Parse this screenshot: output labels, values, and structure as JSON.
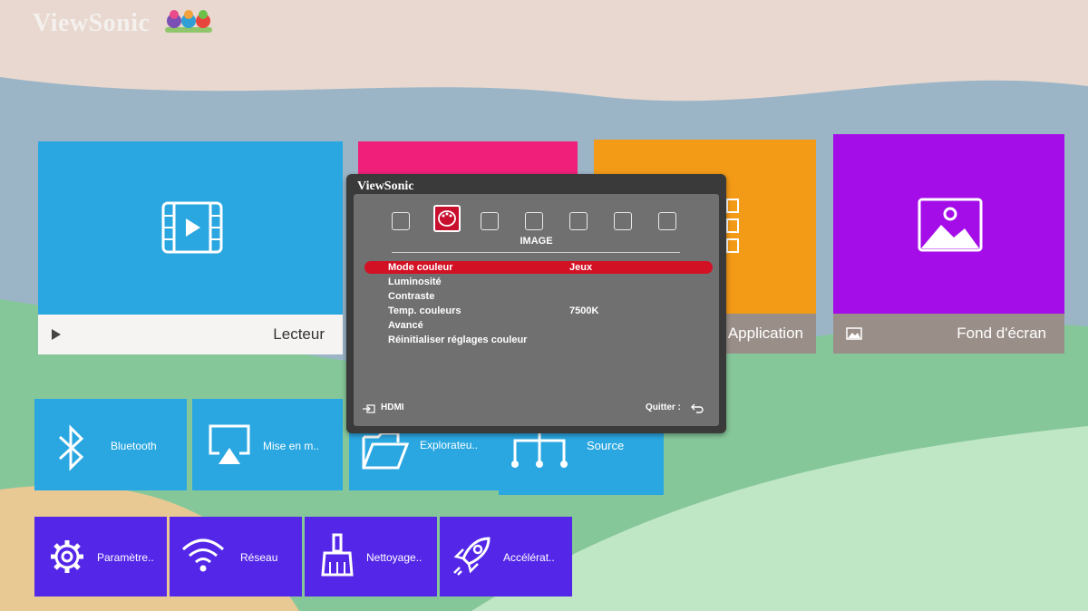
{
  "brand": {
    "name": "ViewSonic"
  },
  "tiles": {
    "lecteur": {
      "label": "Lecteur",
      "icon": "film-play-icon"
    },
    "pink": {
      "label": ""
    },
    "application": {
      "label": "Application",
      "icon": "grid-icon"
    },
    "fond_ecran": {
      "label": "Fond d'écran",
      "icon": "picture-icon"
    },
    "bluetooth": {
      "label": "Bluetooth",
      "icon": "bluetooth-icon"
    },
    "mise_en": {
      "label": "Mise en m..",
      "icon": "screen-cast-icon"
    },
    "explorateur": {
      "label": "Explorateu..",
      "icon": "folder-icon"
    },
    "source": {
      "label": "Source",
      "icon": "source-tree-icon"
    },
    "parametres": {
      "label": "Paramètre..",
      "icon": "gear-icon"
    },
    "reseau": {
      "label": "Réseau",
      "icon": "wifi-icon"
    },
    "nettoyage": {
      "label": "Nettoyage..",
      "icon": "broom-icon"
    },
    "acceleration": {
      "label": "Accélérat..",
      "icon": "rocket-icon"
    }
  },
  "osd": {
    "brand": "ViewSonic",
    "section_title": "IMAGE",
    "tabs": [
      "display-icon",
      "palette-icon",
      "remote-icon",
      "settings-icon",
      "gear-icon",
      "wrench-icon",
      "info-icon"
    ],
    "selected_tab": 1,
    "items": [
      {
        "label": "Mode couleur",
        "value": "Jeux"
      },
      {
        "label": "Luminosité",
        "value": ""
      },
      {
        "label": "Contraste",
        "value": ""
      },
      {
        "label": "Temp. couleurs",
        "value": "7500K"
      },
      {
        "label": "Avancé",
        "value": ""
      },
      {
        "label": "Réinitialiser réglages couleur",
        "value": ""
      }
    ],
    "selected_item": 0,
    "footer_source": "HDMI",
    "footer_quit": "Quitter :"
  },
  "colors": {
    "tile_blue": "#2aa7e1",
    "tile_pink": "#f01f7a",
    "tile_orange": "#f39a17",
    "tile_purple": "#a40ce8",
    "tile_violet": "#5427e8",
    "osd_highlight": "#d31125"
  }
}
